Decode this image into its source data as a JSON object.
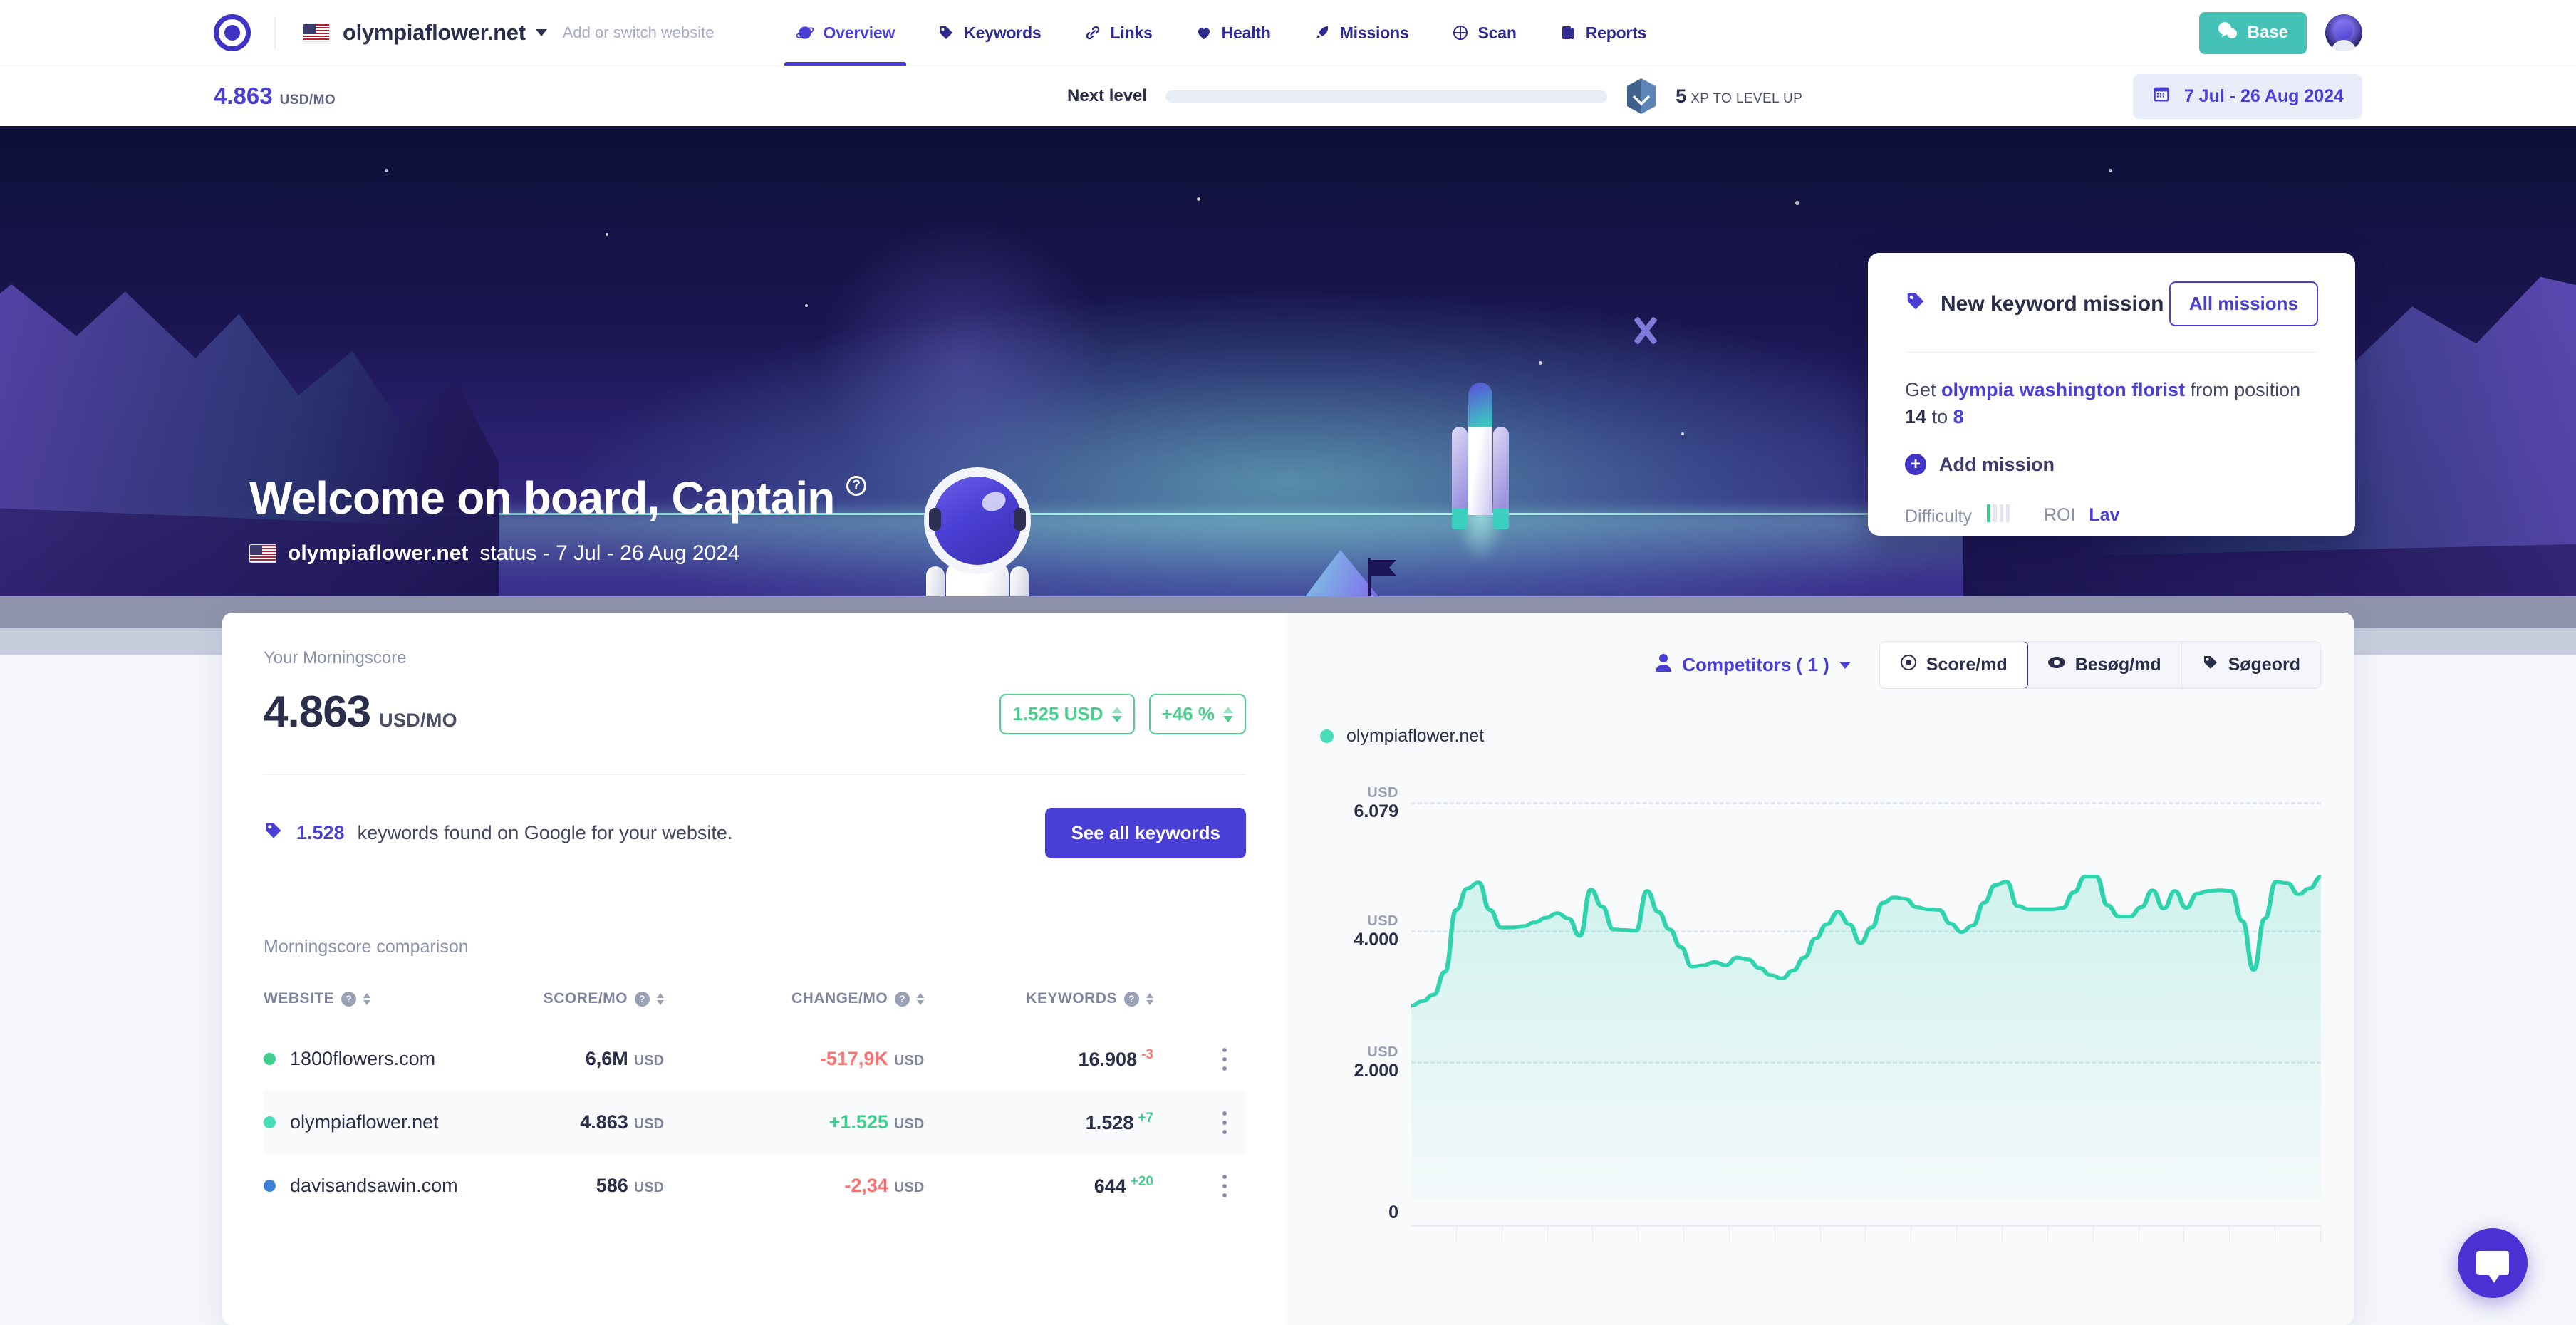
{
  "topnav": {
    "site_name": "olympiaflower.net",
    "add_site": "Add or switch website",
    "tabs": [
      {
        "label": "Overview",
        "icon": "planet-icon",
        "active": true
      },
      {
        "label": "Keywords",
        "icon": "tag-icon",
        "active": false
      },
      {
        "label": "Links",
        "icon": "link-icon",
        "active": false
      },
      {
        "label": "Health",
        "icon": "heart-icon",
        "active": false
      },
      {
        "label": "Missions",
        "icon": "rocket-icon",
        "active": false
      },
      {
        "label": "Scan",
        "icon": "scan-icon",
        "active": false
      },
      {
        "label": "Reports",
        "icon": "report-icon",
        "active": false
      }
    ],
    "base_button": "Base"
  },
  "subheader": {
    "score_value": "4.863",
    "score_unit": "USD/MO",
    "next_level_label": "Next level",
    "xp_number": "5",
    "xp_text": "XP TO LEVEL UP",
    "date_range": "7 Jul - 26 Aug 2024"
  },
  "hero": {
    "title": "Welcome on board, Captain",
    "help_badge": "?",
    "subtitle_site": "olympiaflower.net",
    "subtitle_rest": "status - 7 Jul - 26 Aug 2024"
  },
  "mission": {
    "title": "New keyword mission",
    "all_missions": "All missions",
    "line_get": "Get",
    "keyword": "olympia washington florist",
    "line_from": "from position",
    "pos_from": "14",
    "line_to": "to",
    "pos_to": "8",
    "add_mission": "Add mission",
    "difficulty_label": "Difficulty",
    "difficulty_filled": 1,
    "difficulty_total": 4,
    "roi_label": "ROI",
    "roi_value": "Lav"
  },
  "morningscore": {
    "panel_label": "Your Morningscore",
    "score": "4.863",
    "unit": "USD/MO",
    "chip_abs": "1.525 USD",
    "chip_pct": "+46 %",
    "keywords_count": "1.528",
    "keywords_text": "keywords found on Google for your website.",
    "see_all_button": "See all keywords"
  },
  "comparison": {
    "title": "Morningscore comparison",
    "columns": [
      "WEBSITE",
      "SCORE/MO",
      "CHANGE/MO",
      "KEYWORDS"
    ],
    "rows": [
      {
        "website": "1800flowers.com",
        "color": "#3ecf8e",
        "score": "6,6M",
        "score_unit": "USD",
        "change": "-517,9K",
        "change_unit": "USD",
        "change_sign": "neg",
        "keywords": "16.908",
        "keywords_delta": "-3",
        "keywords_delta_sign": "neg",
        "highlight": false
      },
      {
        "website": "olympiaflower.net",
        "color": "#46ddb8",
        "score": "4.863",
        "score_unit": "USD",
        "change": "+1.525",
        "change_unit": "USD",
        "change_sign": "pos",
        "keywords": "1.528",
        "keywords_delta": "+7",
        "keywords_delta_sign": "pos",
        "highlight": true
      },
      {
        "website": "davisandsawin.com",
        "color": "#3b82d6",
        "score": "586",
        "score_unit": "USD",
        "change": "-2,34",
        "change_unit": "USD",
        "change_sign": "neg",
        "keywords": "644",
        "keywords_delta": "+20",
        "keywords_delta_sign": "pos",
        "highlight": false
      }
    ]
  },
  "chart_panel": {
    "competitors_label": "Competitors ( 1 )",
    "segments": [
      {
        "label": "Score/md",
        "icon": "target-icon",
        "active": true
      },
      {
        "label": "Besøg/md",
        "icon": "eye-icon",
        "active": false
      },
      {
        "label": "Søgeord",
        "icon": "tag-icon",
        "active": false
      }
    ],
    "legend": "olympiaflower.net"
  },
  "chart_data": {
    "type": "area",
    "title": "",
    "series": [
      {
        "name": "olympiaflower.net",
        "color": "#2fd3ae",
        "values": [
          2980,
          3050,
          3150,
          3500,
          4450,
          4780,
          4870,
          4450,
          4180,
          4180,
          4200,
          4260,
          4330,
          4400,
          4320,
          4050,
          4760,
          4500,
          4150,
          4140,
          4130,
          4740,
          4420,
          4150,
          3880,
          3580,
          3600,
          3650,
          3600,
          3720,
          3690,
          3560,
          3450,
          3400,
          3520,
          3720,
          4010,
          4230,
          4420,
          4230,
          3940,
          4180,
          4560,
          4640,
          4620,
          4490,
          4460,
          4450,
          4240,
          4110,
          4210,
          4560,
          4830,
          4880,
          4510,
          4460,
          4460,
          4460,
          4480,
          4720,
          4960,
          4960,
          4520,
          4350,
          4350,
          4490,
          4750,
          4470,
          4740,
          4480,
          4700,
          4740,
          4750,
          4740,
          4280,
          3530,
          4320,
          4880,
          4860,
          4690,
          4780,
          4960
        ]
      }
    ],
    "ylabels": [
      {
        "unit": "USD",
        "value": "6.079",
        "y": 6079
      },
      {
        "unit": "USD",
        "value": "4.000",
        "y": 4000
      },
      {
        "unit": "USD",
        "value": "2.000",
        "y": 2000
      },
      {
        "unit": "",
        "value": "0",
        "y": 0
      }
    ],
    "ylim": [
      0,
      6079
    ],
    "grid": true,
    "legend_position": "top-left",
    "xlabel": "",
    "ylabel": "USD"
  }
}
